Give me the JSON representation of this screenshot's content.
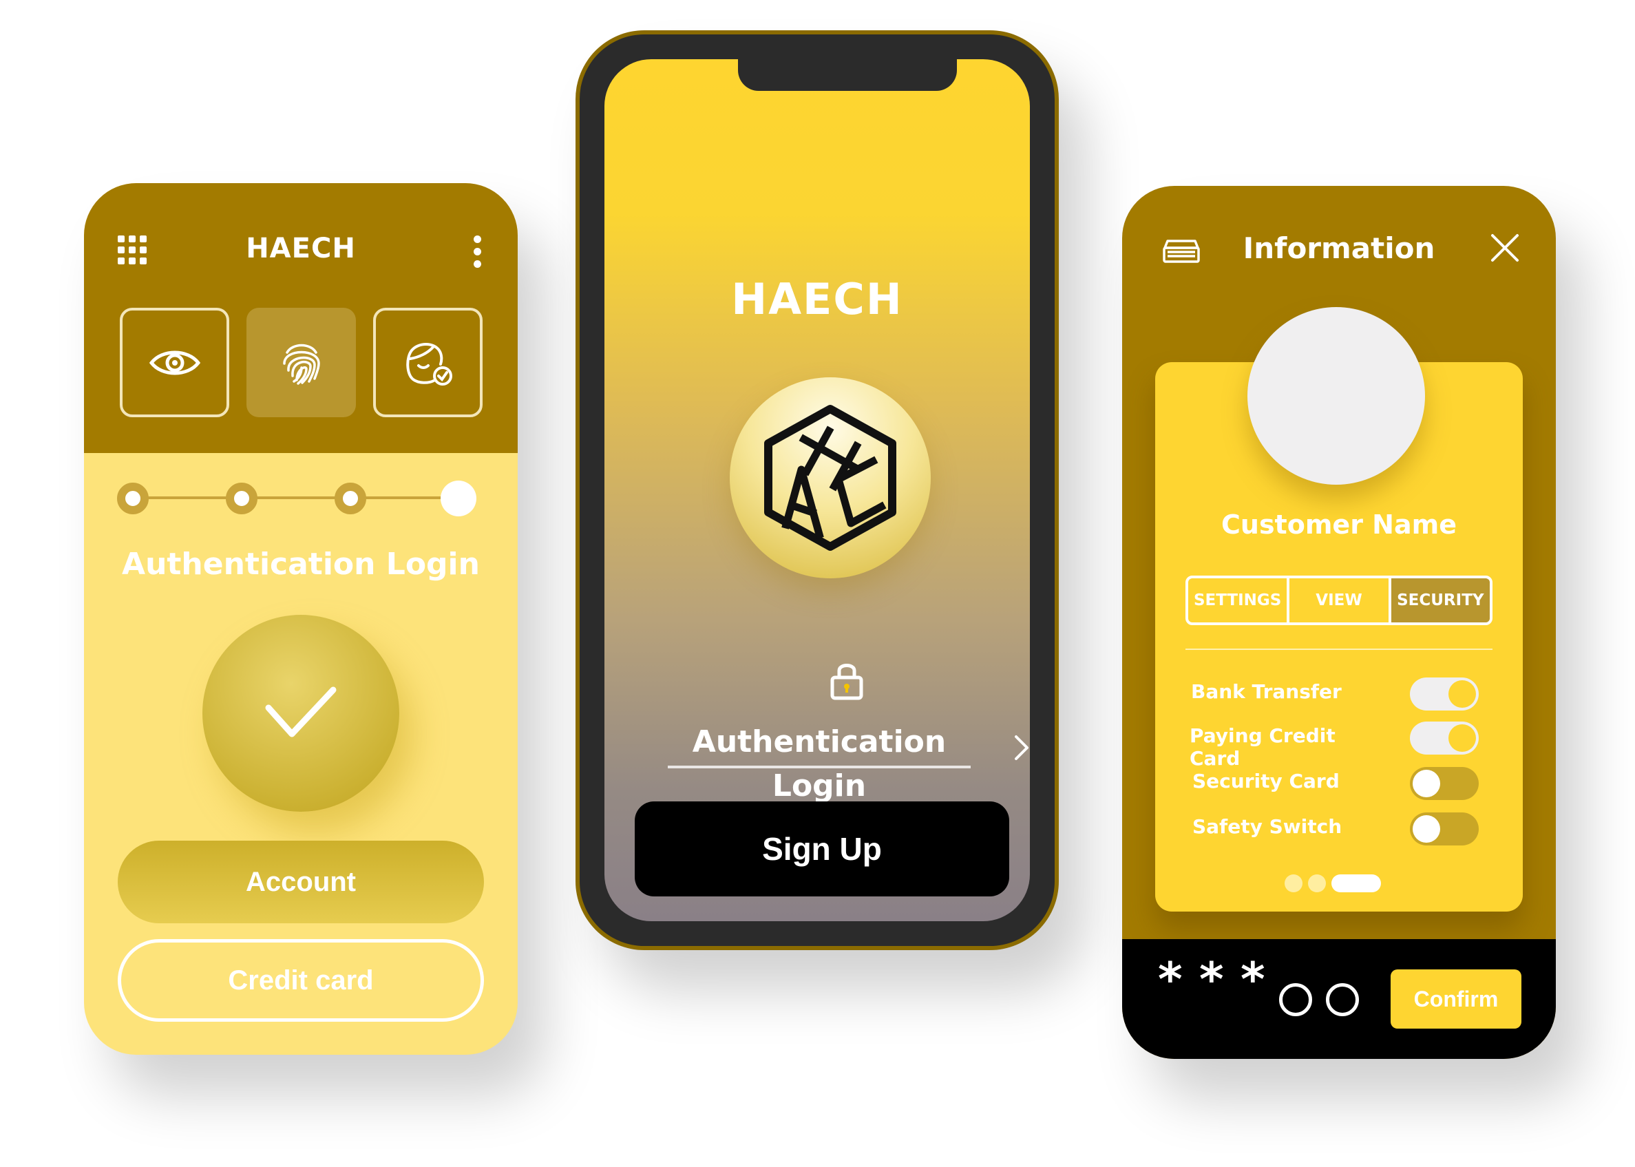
{
  "left_screen": {
    "app_title": "HAECH",
    "auth_methods": [
      {
        "icon": "eye-icon",
        "selected": false
      },
      {
        "icon": "fingerprint-icon",
        "selected": true
      },
      {
        "icon": "face-id-icon",
        "selected": false
      }
    ],
    "steps_total": 4,
    "current_step": 4,
    "auth_label": "Authentication Login",
    "account_button": "Account",
    "credit_card_button": "Credit card"
  },
  "center_screen": {
    "app_title": "HAECH",
    "logo_icon": "cube-logo-icon",
    "auth_link": "Authentication Login",
    "signup_button": "Sign Up"
  },
  "right_screen": {
    "title": "Information",
    "customer_name": "Customer Name",
    "tabs": [
      {
        "label": "SETTINGS",
        "active": false
      },
      {
        "label": "VIEW",
        "active": false
      },
      {
        "label": "SECURITY",
        "active": true
      }
    ],
    "toggles": [
      {
        "label": "Bank Transfer",
        "on": true
      },
      {
        "label": "Paying Credit Card",
        "on": true
      },
      {
        "label": "Security Card",
        "on": false
      },
      {
        "label": "Safety Switch",
        "on": false
      }
    ],
    "page_indicator": {
      "total": 3,
      "active": 3
    },
    "pin": {
      "entered_symbol": "*",
      "entered": 3,
      "total": 5
    },
    "confirm_button": "Confirm"
  },
  "colors": {
    "accent_dark": "#a37b00",
    "accent_yellow": "#fed531",
    "pale_yellow": "#fde37a"
  }
}
